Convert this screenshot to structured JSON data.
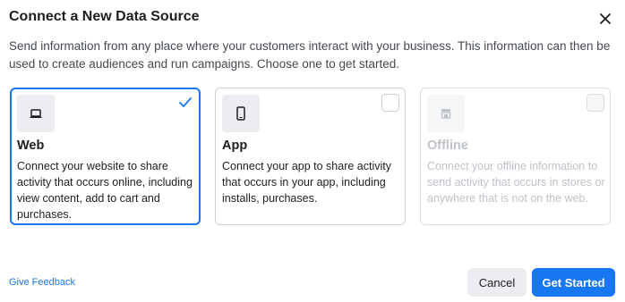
{
  "dialog": {
    "title": "Connect a New Data Source",
    "description": "Send information from any place where your customers interact with your business. This information can then be used to create audiences and run campaigns. Choose one to get started."
  },
  "options": [
    {
      "title": "Web",
      "description": "Connect your website to share activity that occurs online, including view content, add to cart and purchases.",
      "icon": "laptop-icon",
      "state": "selected"
    },
    {
      "title": "App",
      "description": "Connect your app to share activity that occurs in your app, including installs, purchases.",
      "icon": "phone-icon",
      "state": "unselected"
    },
    {
      "title": "Offline",
      "description": "Connect your offline information to send activity that occurs in stores or anywhere that is not on the web.",
      "icon": "store-icon",
      "state": "disabled"
    }
  ],
  "footer": {
    "feedback_label": "Give Feedback",
    "cancel_label": "Cancel",
    "start_label": "Get Started"
  },
  "colors": {
    "accent": "#1877f2",
    "disabled_text": "#bec3c9",
    "border": "#ccd0d5"
  }
}
